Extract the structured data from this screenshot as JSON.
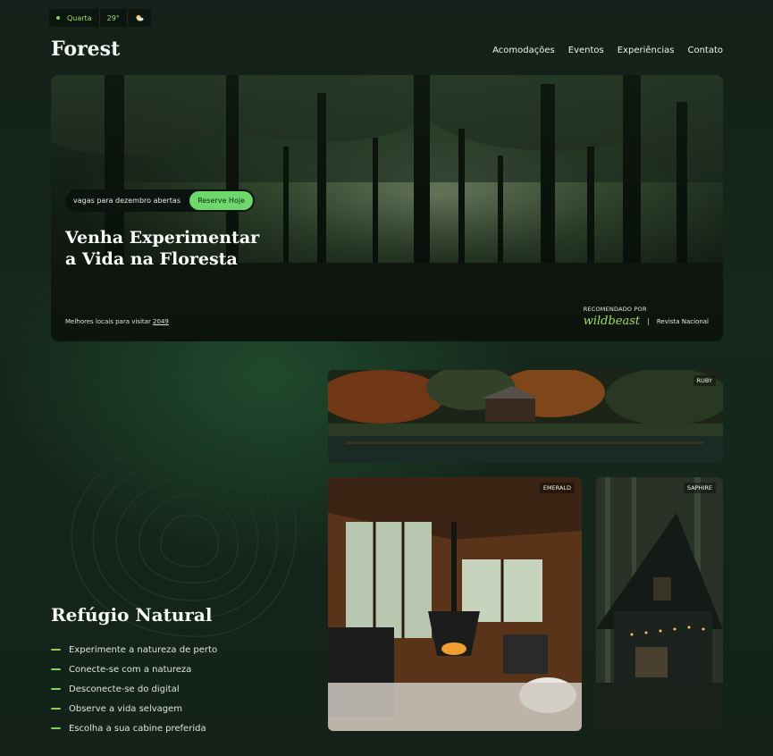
{
  "weather": {
    "day": "Quarta",
    "temp": "29°",
    "icon": "partly-cloudy-icon"
  },
  "brand": {
    "logo": "Forest"
  },
  "nav": {
    "items": [
      "Acomodações",
      "Eventos",
      "Experiências",
      "Contato"
    ]
  },
  "hero": {
    "pill_text": "vagas para dezembro abertas",
    "cta_label": "Reserve Hoje",
    "title_line1": "Venha Experimentar",
    "title_line2": "a Vida na Floresta",
    "best_prefix": "Melhores locais para visitar",
    "best_year": "2049",
    "recommended_label": "RECOMENDADO POR",
    "recommended_brand": "wildbeast",
    "recommended_separator": "|",
    "recommended_second": "Revista Nacional"
  },
  "cabins": {
    "ruby": "RUBY",
    "emerald": "EMERALD",
    "saphire": "SAPHIRE"
  },
  "section": {
    "title": "Refúgio Natural",
    "features": [
      "Experimente a natureza de perto",
      "Conecte-se com a natureza",
      "Desconecte-se do digital",
      "Observe a vida selvagem",
      "Escolha a sua cabine preferida"
    ]
  },
  "colors": {
    "background": "#13221a",
    "accent": "#7fd45a",
    "button": "#6fd86c"
  }
}
